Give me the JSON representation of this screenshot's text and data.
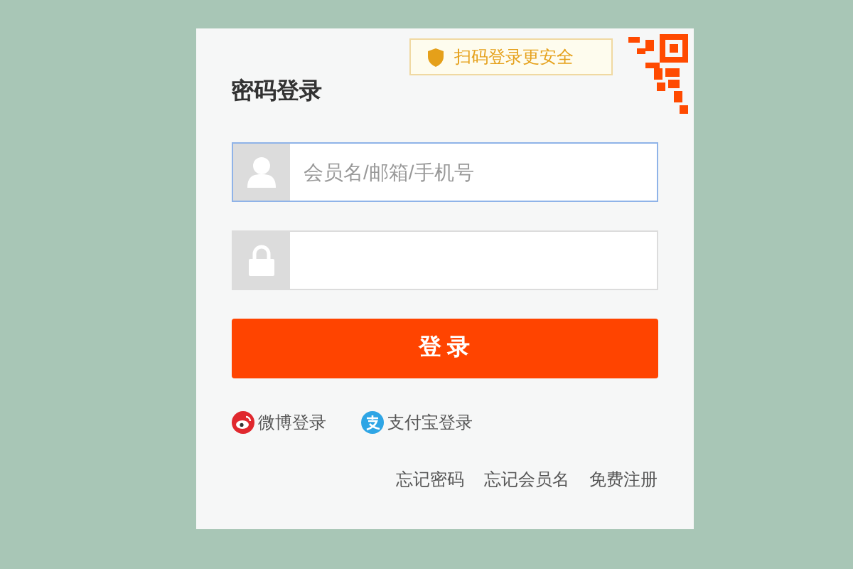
{
  "qr_tip": "扫码登录更安全",
  "title": "密码登录",
  "fields": [
    {
      "kind": "user",
      "placeholder": "会员名/邮箱/手机号",
      "focused": true
    },
    {
      "kind": "password",
      "focused": false
    }
  ],
  "submit": "登 录",
  "third_party": [
    {
      "kind": "weibo",
      "label": "微博登录",
      "color": "#e0282e"
    },
    {
      "kind": "alipay",
      "label": "支付宝登录",
      "color": "#2ea5e5"
    }
  ],
  "links": [
    "忘记密码",
    "忘记会员名",
    "免费注册"
  ]
}
